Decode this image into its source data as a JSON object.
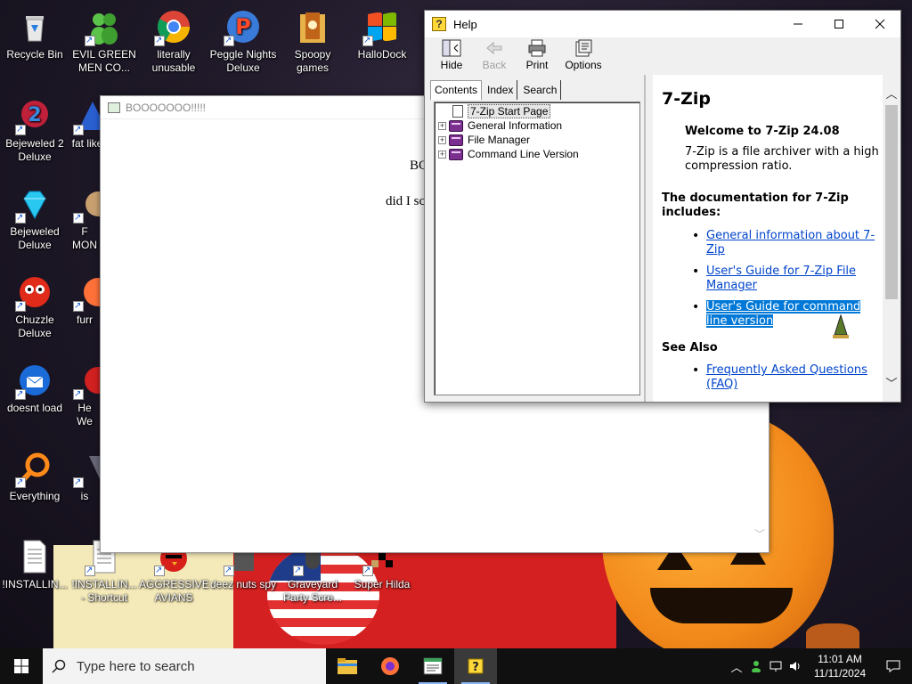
{
  "desktop": {
    "icons": [
      {
        "id": "recycle-bin",
        "label": "Recycle Bin"
      },
      {
        "id": "evil-green-men",
        "label": "EVIL GREEN MEN CO..."
      },
      {
        "id": "chrome",
        "label": "literally unusable"
      },
      {
        "id": "peggle",
        "label": "Peggle Nights Deluxe"
      },
      {
        "id": "spoopy",
        "label": "Spoopy games"
      },
      {
        "id": "hallodock",
        "label": "HalloDock"
      },
      {
        "id": "bejeweled2",
        "label": "Bejeweled 2 Deluxe"
      },
      {
        "id": "fat-like",
        "label": "fat like"
      },
      {
        "id": "bejeweled",
        "label": "Bejeweled Deluxe"
      },
      {
        "id": "f-mon",
        "label": "F MON"
      },
      {
        "id": "chuzzle",
        "label": "Chuzzle Deluxe"
      },
      {
        "id": "furr",
        "label": "furr"
      },
      {
        "id": "thunderbird",
        "label": "doesnt load"
      },
      {
        "id": "he-we",
        "label": "He We"
      },
      {
        "id": "everything",
        "label": "Everything"
      },
      {
        "id": "is",
        "label": "is"
      },
      {
        "id": "installing1",
        "label": "!INSTALLIN..."
      },
      {
        "id": "installing2",
        "label": "!INSTALLIN... - Shortcut"
      },
      {
        "id": "aggressive-avians",
        "label": "AGGRESSIVE AVIANS"
      },
      {
        "id": "deez-nuts",
        "label": "deez nuts spy"
      },
      {
        "id": "graveyard",
        "label": "Graveyard Party Scre..."
      },
      {
        "id": "super-hilda",
        "label": "Super Hilda"
      }
    ]
  },
  "main_window": {
    "title": "BOOOOOOO!!!!!",
    "line1": "BO",
    "line2": "did I sc"
  },
  "help_window": {
    "title": "Help",
    "toolbar": {
      "hide": "Hide",
      "back": "Back",
      "print": "Print",
      "options": "Options"
    },
    "tabs": {
      "contents": "Contents",
      "index": "Index",
      "search": "Search"
    },
    "tree": [
      {
        "label": "7-Zip Start Page",
        "type": "page",
        "selected": true
      },
      {
        "label": "General Information",
        "type": "book"
      },
      {
        "label": "File Manager",
        "type": "book"
      },
      {
        "label": "Command Line Version",
        "type": "book"
      }
    ],
    "doc": {
      "heading": "7-Zip",
      "welcome": "Welcome to 7-Zip 24.08",
      "intro": "7-Zip is a file archiver with a high compression ratio.",
      "docs_heading": "The documentation for 7-Zip includes:",
      "links": [
        "General information about 7-Zip",
        "User's Guide for 7-Zip File Manager",
        "User's Guide for command line version"
      ],
      "see_also": "See Also",
      "faq": "Frequently Asked Questions (FAQ)"
    }
  },
  "taskbar": {
    "search_placeholder": "Type here to search",
    "time": "11:01 AM",
    "date": "11/11/2024"
  },
  "colors": {
    "taskbar": "#101010",
    "link": "#0044cc",
    "highlight": "#0078d7"
  }
}
